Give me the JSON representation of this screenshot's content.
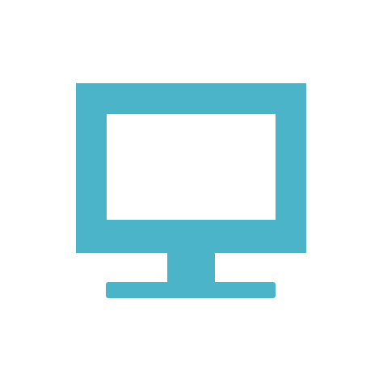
{
  "icon": {
    "name": "monitor-icon",
    "color": "#4BB4C8",
    "background": "#FFFFFF"
  }
}
